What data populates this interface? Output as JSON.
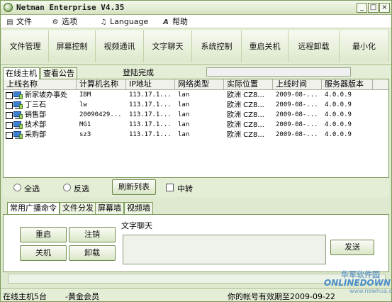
{
  "window": {
    "title": "Netman Enterprise V4.35",
    "controls": [
      "_",
      "□",
      "×"
    ]
  },
  "menu": [
    {
      "label": "文件",
      "icon": "file-icon",
      "glyph": "▤"
    },
    {
      "label": "选项",
      "icon": "options-icon",
      "glyph": "⚙"
    },
    {
      "label": "Language",
      "icon": "language-icon",
      "glyph": "♫"
    },
    {
      "label": "帮助",
      "icon": "help-icon",
      "glyph": "A"
    }
  ],
  "toolbar": [
    "文件管理",
    "屏幕控制",
    "视频通讯",
    "文字聊天",
    "系统控制",
    "重启关机",
    "远程卸载",
    "最小化"
  ],
  "tabs": [
    "在线主机",
    "查看公告"
  ],
  "login_status": "登陆完成",
  "table": {
    "columns": [
      "上线名称",
      "计算机名称",
      "IP地址",
      "网络类型",
      "实际位置",
      "上线时间",
      "服务器版本"
    ],
    "rows": [
      [
        "新家坡办事处",
        "IBM",
        "113.17.1...",
        "lan",
        "欧洲 CZ8...",
        "2009-08-...",
        "4.0.0.9"
      ],
      [
        "丁三石",
        "lw",
        "113.17.1...",
        "lan",
        "欧洲 CZ8...",
        "2009-08-...",
        "4.0.0.9"
      ],
      [
        "销售部",
        "20090429...",
        "113.17.1...",
        "lan",
        "欧洲 CZ8...",
        "2009-08-...",
        "4.0.0.9"
      ],
      [
        "技术部",
        "MG1",
        "113.17.1...",
        "lan",
        "欧洲 CZ8...",
        "2009-08-...",
        "4.0.0.9"
      ],
      [
        "采购部",
        "sz3",
        "113.17.1...",
        "lan",
        "欧洲 CZ8...",
        "2009-08-...",
        "4.0.0.9"
      ]
    ]
  },
  "selection": {
    "select_all": "全选",
    "invert": "反选",
    "refresh": "刷新列表",
    "relay": "中转"
  },
  "lower_tabs": [
    "常用广播命令",
    "文件分发",
    "屏幕墙",
    "视频墙"
  ],
  "commands": {
    "restart": "重启",
    "logout": "注销",
    "shutdown": "关机",
    "uninstall": "卸载"
  },
  "chat": {
    "label": "文字聊天",
    "send": "发送"
  },
  "status": {
    "online": "在线主机5台",
    "member": "-黄金会员",
    "expiry": "你的帐号有效期至2009-09-22"
  },
  "watermark": {
    "cn": "华军软件园",
    "en": "ONLINEDOWN",
    "url": "www.newhua.com"
  }
}
